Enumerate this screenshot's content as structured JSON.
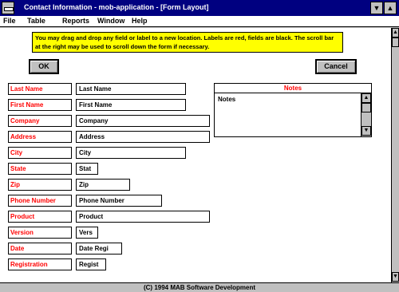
{
  "window": {
    "title": "Contact Information - mob-application - [Form Layout]",
    "minimize_glyph": "▼",
    "maximize_glyph": "▲"
  },
  "menu": {
    "items": [
      "File",
      "Table",
      "Reports",
      "Window",
      "Help"
    ]
  },
  "info_text": "You may drag and drop any field or label to a new location. Labels are red, fields are black. The scroll bar at the right may be used to scroll down the form if necessary.",
  "buttons": {
    "ok": "OK",
    "cancel": "Cancel"
  },
  "form": {
    "rows": [
      {
        "label": "Last Name",
        "field": "Last Name"
      },
      {
        "label": "First Name",
        "field": "First Name"
      },
      {
        "label": "Company",
        "field": "Company"
      },
      {
        "label": "Address",
        "field": "Address"
      },
      {
        "label": "City",
        "field": "City"
      },
      {
        "label": "State",
        "field": "Stat"
      },
      {
        "label": "Zip",
        "field": "Zip"
      },
      {
        "label": "Phone Number",
        "field": "Phone Number"
      },
      {
        "label": "Product",
        "field": "Product"
      },
      {
        "label": "Version",
        "field": "Vers"
      },
      {
        "label": "Date",
        "field": "Date Regi"
      },
      {
        "label": "Registration",
        "field": "Regist"
      }
    ]
  },
  "notes": {
    "header": "Notes",
    "field": "Notes"
  },
  "status": "(C) 1994 MAB Software Development",
  "colors": {
    "title_bar": "#000080",
    "label_text": "#ff0000",
    "info_bg": "#ffff00"
  }
}
